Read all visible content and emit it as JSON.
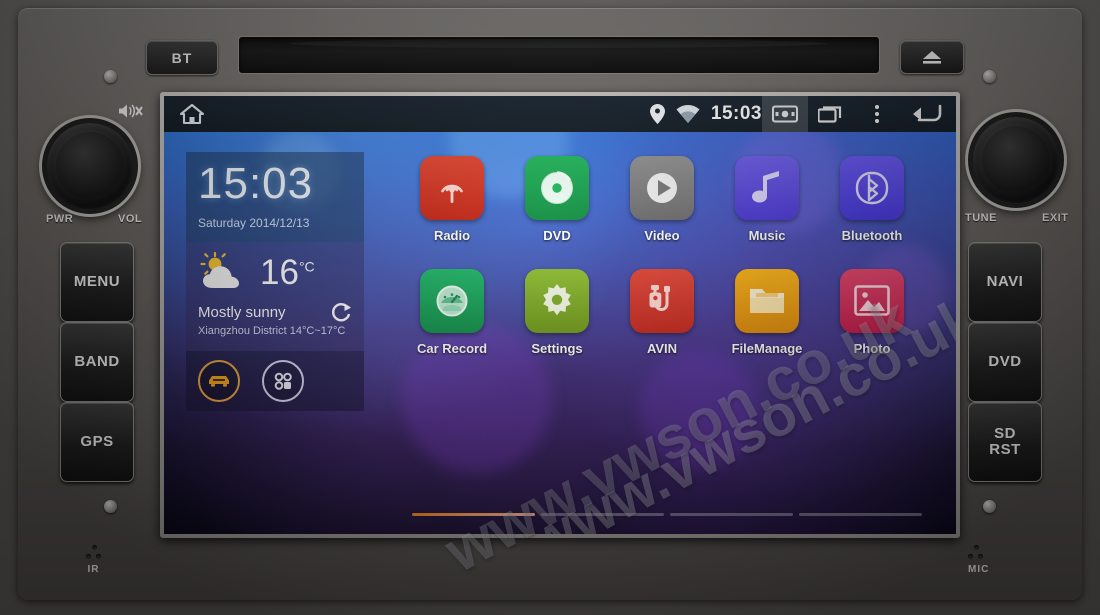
{
  "device": {
    "name": "Android Car Stereo Head Unit",
    "top_controls": {
      "bt_button": "BT",
      "eject_icon": "eject-icon",
      "disc_slot": "disc-slot"
    },
    "left_panel": {
      "knob_label_left": "PWR",
      "knob_label_right": "VOL",
      "mute_icon": "mute-icon",
      "buttons": [
        {
          "label": "MENU"
        },
        {
          "label": "BAND"
        },
        {
          "label": "GPS"
        }
      ]
    },
    "right_panel": {
      "knob_label_left": "TUNE",
      "knob_label_right": "EXIT",
      "buttons": [
        {
          "label": "NAVI"
        },
        {
          "label": "DVD"
        },
        {
          "label": "SD\nRST",
          "line1": "SD",
          "line2": "RST"
        }
      ]
    },
    "bottom_labels": {
      "ir": "IR",
      "mic": "MIC"
    }
  },
  "screen": {
    "statusbar": {
      "home_icon": "home-icon",
      "location_icon": "location-pin-icon",
      "wifi_icon": "wifi-icon",
      "time": "15:03",
      "screenshot_icon": "screenshot-icon",
      "recents_icon": "recent-apps-icon",
      "overflow_icon": "overflow-menu-icon",
      "back_icon": "back-arrow-icon"
    },
    "clock_widget": {
      "time": "15:03",
      "date": "Saturday 2014/12/13"
    },
    "weather_widget": {
      "icon": "sun-behind-cloud-icon",
      "temperature": "16",
      "unit": "°C",
      "condition": "Mostly sunny",
      "location_range": "Xiangzhou District 14°C~17°C",
      "refresh_icon": "refresh-icon"
    },
    "dock": {
      "car_mode_icon": "car-icon",
      "app_drawer_icon": "app-drawer-icon"
    },
    "apps": [
      [
        {
          "label": "Radio",
          "icon": "radio-antenna-icon",
          "color": "#d9301e"
        },
        {
          "label": "DVD",
          "icon": "disc-icon",
          "color": "#12a34a"
        },
        {
          "label": "Video",
          "icon": "play-circle-icon",
          "color": "#7d7d7d"
        },
        {
          "label": "Music",
          "icon": "music-note-icon",
          "color": "#5b4ae0"
        },
        {
          "label": "Bluetooth",
          "icon": "bluetooth-icon",
          "color": "#5546e6"
        }
      ],
      [
        {
          "label": "Car Record",
          "icon": "dashcam-gauge-icon",
          "color": "#17a35a"
        },
        {
          "label": "Settings",
          "icon": "gear-icon",
          "color": "#7aa822"
        },
        {
          "label": "AVIN",
          "icon": "av-plug-icon",
          "color": "#dc3226"
        },
        {
          "label": "FileManage",
          "icon": "folder-icon",
          "color": "#f0a013"
        },
        {
          "label": "Photo",
          "icon": "photo-icon",
          "color": "#d6305b"
        }
      ]
    ],
    "pager": {
      "pages": 4,
      "active": 1
    }
  },
  "watermark": {
    "line1": "www.vwson.co.uk",
    "line2": "www.vwson.co.uk"
  }
}
